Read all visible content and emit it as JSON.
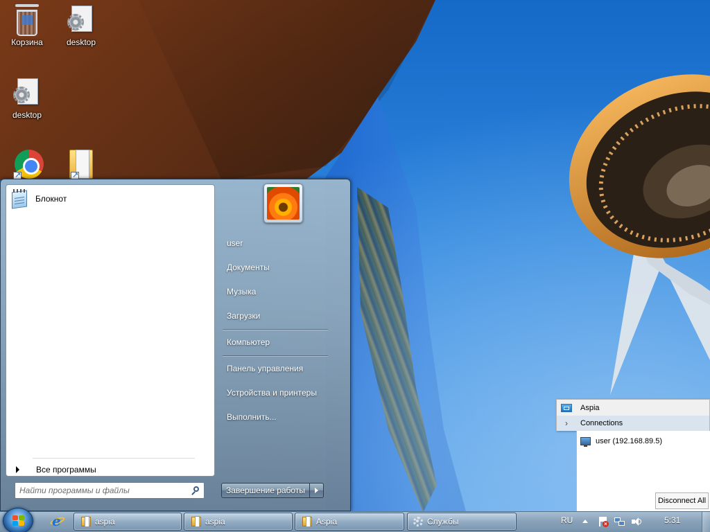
{
  "desktop": {
    "icons": [
      {
        "label": "Корзина",
        "icon": "recycle-bin-icon"
      },
      {
        "label": "desktop",
        "icon": "settings-file-icon"
      },
      {
        "label": "desktop",
        "icon": "settings-file-icon"
      },
      {
        "label": "",
        "icon": "chrome-icon"
      },
      {
        "label": "",
        "icon": "folder-shortcut-icon"
      }
    ]
  },
  "start_menu": {
    "pinned_programs": [
      {
        "label": "Блокнот",
        "icon": "notepad-icon"
      }
    ],
    "all_programs_label": "Все программы",
    "search": {
      "placeholder": "Найти программы и файлы",
      "value": ""
    },
    "user_avatar_icon": "flower-avatar-icon",
    "right_items": [
      {
        "label": "user"
      },
      {
        "label": "Документы"
      },
      {
        "label": "Музыка"
      },
      {
        "label": "Загрузки"
      },
      {
        "label": "Компьютер"
      },
      {
        "label": "Панель управления"
      },
      {
        "label": "Устройства и принтеры"
      },
      {
        "label": "Выполнить..."
      }
    ],
    "shutdown_label": "Завершение работы"
  },
  "aspia_popup": {
    "menu": [
      {
        "label": "Aspia",
        "icon": "aspia-icon"
      },
      {
        "label": "Connections",
        "icon": "chevron-right-icon"
      }
    ],
    "connections": [
      {
        "label": "user (192.168.89.5)",
        "icon": "monitor-icon"
      }
    ],
    "disconnect_all_label": "Disconnect All"
  },
  "taskbar": {
    "buttons": [
      {
        "label": "aspia",
        "icon": "folder-icon"
      },
      {
        "label": "aspia",
        "icon": "folder-icon"
      },
      {
        "label": "Aspia",
        "icon": "folder-icon"
      },
      {
        "label": "Службы",
        "icon": "gear-icon"
      }
    ],
    "language": "RU",
    "clock": "5:31"
  }
}
